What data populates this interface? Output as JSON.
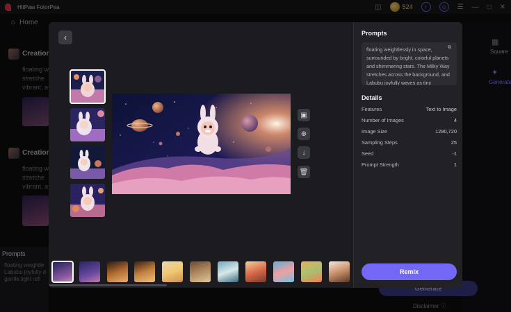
{
  "app": {
    "title": "HitPaw FotorPea",
    "coins": "524"
  },
  "nav": {
    "home_label": "Home"
  },
  "background": {
    "creation_label_1": "Creation",
    "creation_text_1a": "floating weightl",
    "creation_text_1b": "stretche",
    "creation_text_1c": "vibrant, a",
    "creation_label_2": "Creation",
    "creation_text_2a": "floating weightl",
    "creation_text_2b": "stretche",
    "creation_text_2c": "vibrant, a",
    "prompts_title": "Prompts",
    "prompts_text": "floating weightle Labubu joyfully d gentle light refl",
    "right_square": "Square",
    "right_generate": "Generate",
    "generate_label": "Generate",
    "disclaimer": "Disclaimer"
  },
  "modal": {
    "prompts_title": "Prompts",
    "prompt_text": "floating weightlessly in space, surrounded by bright, colorful planets and shimmering stars. The Milky Way stretches across the background, and Labubu joyfully waves as tiny asteroids pass by. The scene has a",
    "details_title": "Details",
    "details": [
      {
        "label": "Features",
        "value": "Text to Image"
      },
      {
        "label": "Number of Images",
        "value": "4"
      },
      {
        "label": "Image Size",
        "value": "1280,720"
      },
      {
        "label": "Sampling Steps",
        "value": "25"
      },
      {
        "label": "Seed",
        "value": "-1"
      },
      {
        "label": "Prompt Strength",
        "value": "1"
      }
    ],
    "remix_label": "Remix",
    "thumbnail_count": 4,
    "strip_count": 11
  },
  "colors": {
    "accent": "#7268f5",
    "coin": "#e6c66a"
  },
  "icons": [
    "back-icon",
    "image-icon",
    "zoom-in-icon",
    "download-icon",
    "trash-icon",
    "copy-icon",
    "home-icon"
  ]
}
